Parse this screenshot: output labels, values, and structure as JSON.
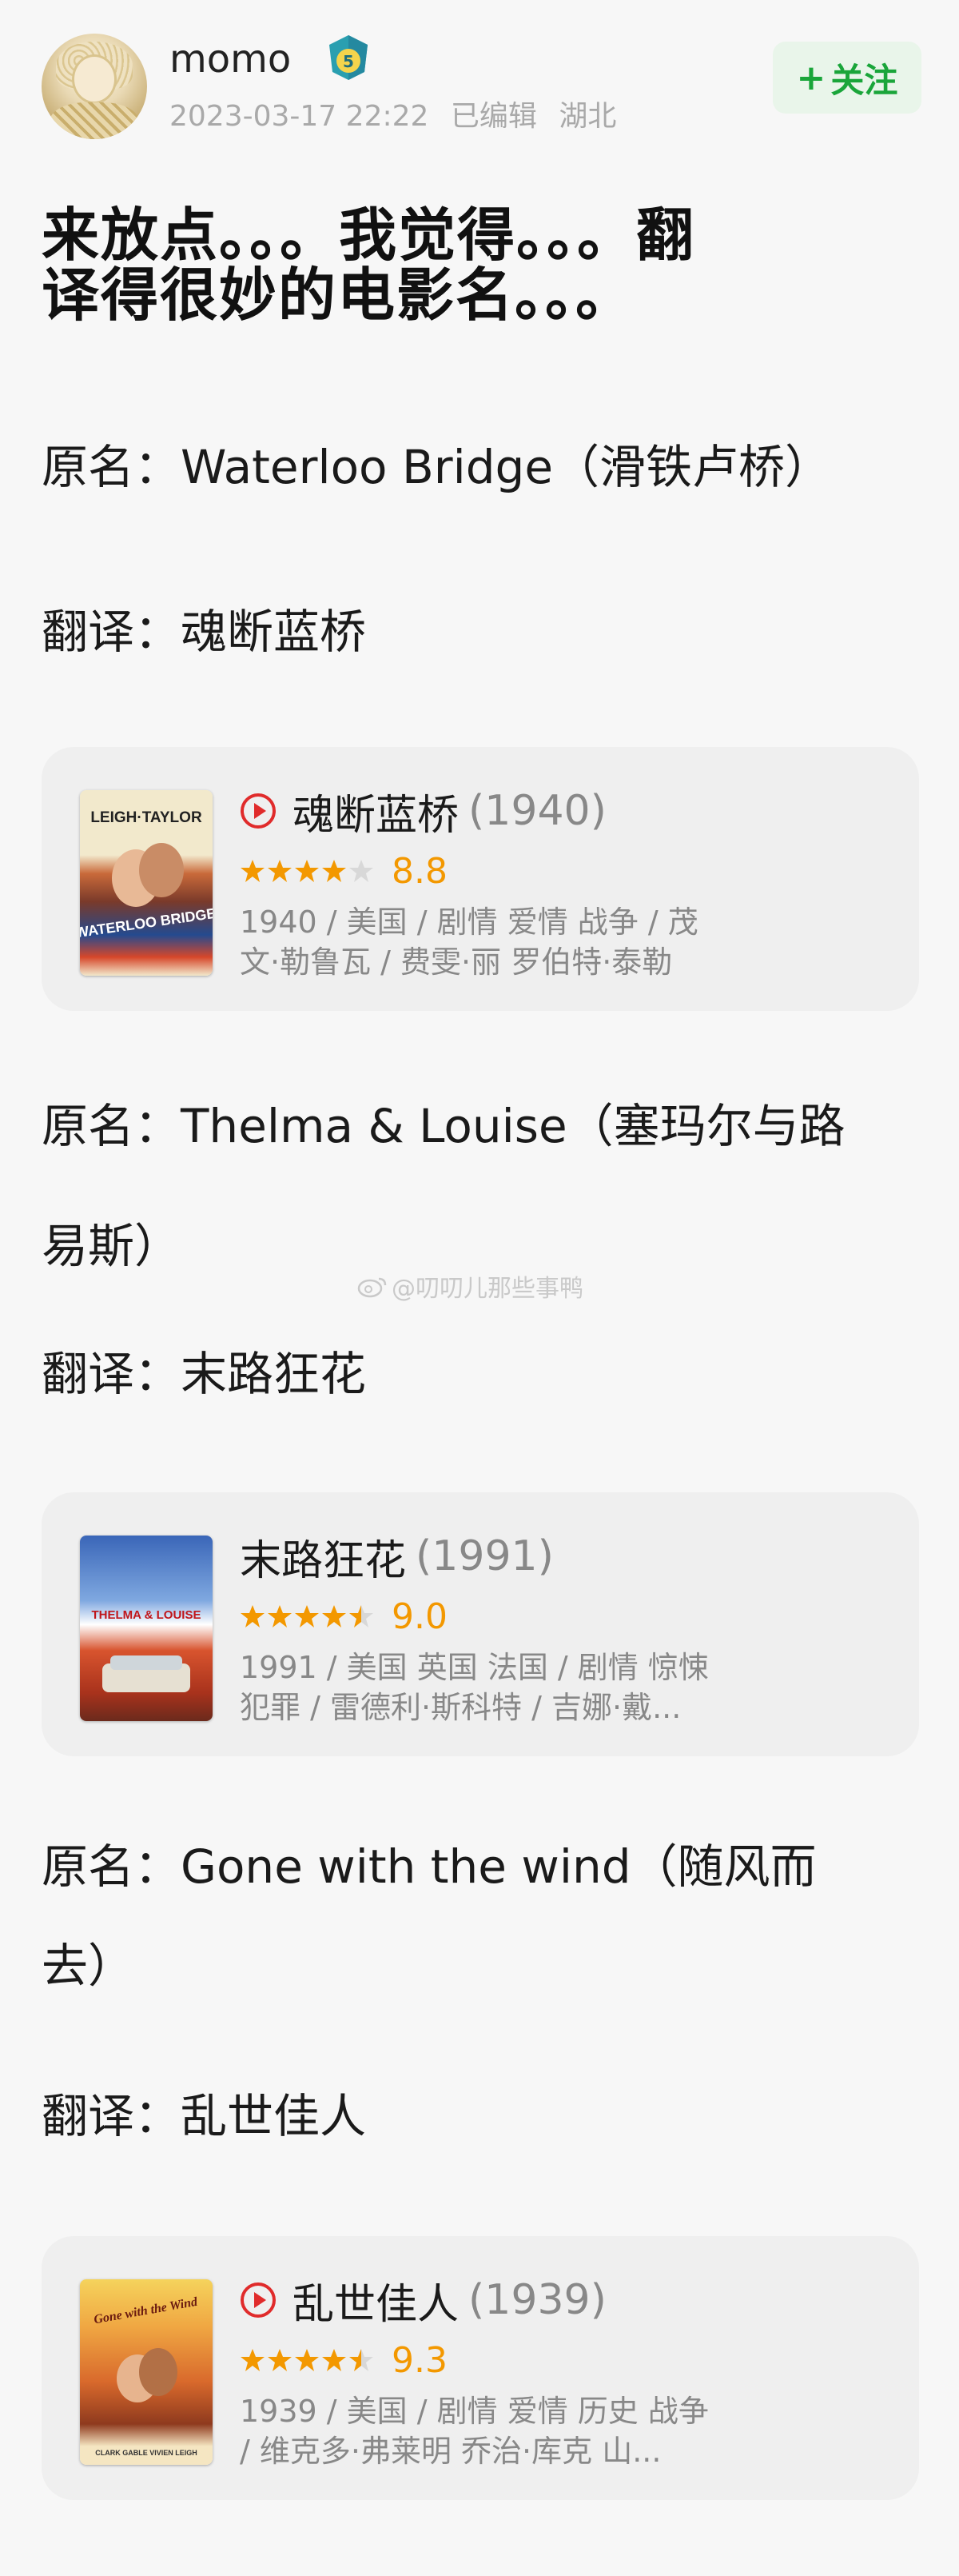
{
  "user": {
    "name": "momo",
    "level": "5",
    "timestamp": "2023-03-17 22:22",
    "edited": "已编辑",
    "location": "湖北",
    "follow_label": "关注"
  },
  "post": {
    "title_line1": "来放点。。。我觉得。。。翻",
    "title_line2": "译得很妙的电影名。。。",
    "blocks": [
      {
        "original_line1": "原名：Waterloo Bridge（滑铁卢桥）",
        "original_line2": "",
        "translation": "翻译：魂断蓝桥"
      },
      {
        "original_line1": "原名：Thelma & Louise（塞玛尔与路",
        "original_line2": "易斯）",
        "translation": "翻译：末路狂花"
      },
      {
        "original_line1": "原名：Gone with the wind（随风而",
        "original_line2": "去）",
        "translation": "翻译：乱世佳人"
      }
    ]
  },
  "movies": [
    {
      "title": "魂断蓝桥",
      "year": "(1940)",
      "score": "8.8",
      "stars": 4,
      "has_play": true,
      "meta_line1": "1940 / 美国 / 剧情 爱情 战争 / 茂",
      "meta_line2": "文·勒鲁瓦 / 费雯·丽 罗伯特·泰勒",
      "poster_text_top": "LEIGH·TAYLOR",
      "poster_text_mid": "WATERLOO BRIDGE"
    },
    {
      "title": "末路狂花",
      "year": "(1991)",
      "score": "9.0",
      "stars": 4.5,
      "has_play": false,
      "meta_line1": "1991 / 美国 英国 法国 / 剧情 惊悚",
      "meta_line2": "犯罪 / 雷德利·斯科特 / 吉娜·戴...",
      "poster_text_top": "THELMA & LOUISE",
      "poster_text_mid": ""
    },
    {
      "title": "乱世佳人",
      "year": "(1939)",
      "score": "9.3",
      "stars": 4.5,
      "has_play": true,
      "meta_line1": "1939 / 美国 / 剧情 爱情 历史 战争",
      "meta_line2": "/ 维克多·弗莱明 乔治·库克 山...",
      "poster_text_top": "Gone with the Wind",
      "poster_text_mid": "CLARK GABLE  VIVIEN LEIGH"
    }
  ],
  "watermark": "@叨叨儿那些事鸭",
  "colors": {
    "accent_green": "#1aa53a",
    "rating_orange": "#f39800",
    "play_red": "#e02b2b"
  }
}
